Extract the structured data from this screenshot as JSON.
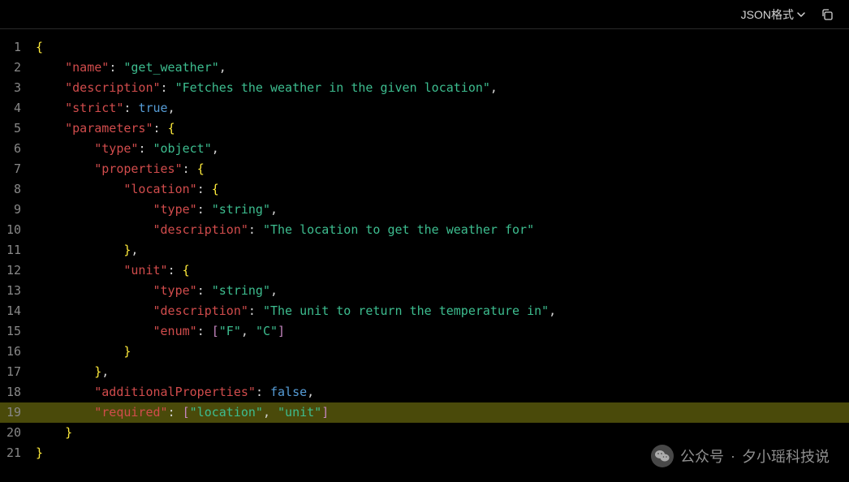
{
  "toolbar": {
    "format_label": "JSON格式"
  },
  "watermark": {
    "label": "公众号",
    "sep": "·",
    "name": "夕小瑶科技说"
  },
  "lines": [
    {
      "num": "1",
      "hl": false,
      "indent": 0,
      "segs": [
        {
          "t": "{",
          "c": "brace"
        }
      ]
    },
    {
      "num": "2",
      "hl": false,
      "indent": 1,
      "segs": [
        {
          "t": "\"name\"",
          "c": "key"
        },
        {
          "t": ": ",
          "c": "punct"
        },
        {
          "t": "\"get_weather\"",
          "c": "string"
        },
        {
          "t": ",",
          "c": "punct"
        }
      ]
    },
    {
      "num": "3",
      "hl": false,
      "indent": 1,
      "segs": [
        {
          "t": "\"description\"",
          "c": "key"
        },
        {
          "t": ": ",
          "c": "punct"
        },
        {
          "t": "\"Fetches the weather in the given location\"",
          "c": "string"
        },
        {
          "t": ",",
          "c": "punct"
        }
      ]
    },
    {
      "num": "4",
      "hl": false,
      "indent": 1,
      "segs": [
        {
          "t": "\"strict\"",
          "c": "key"
        },
        {
          "t": ": ",
          "c": "punct"
        },
        {
          "t": "true",
          "c": "bool"
        },
        {
          "t": ",",
          "c": "punct"
        }
      ]
    },
    {
      "num": "5",
      "hl": false,
      "indent": 1,
      "segs": [
        {
          "t": "\"parameters\"",
          "c": "key"
        },
        {
          "t": ": ",
          "c": "punct"
        },
        {
          "t": "{",
          "c": "brace"
        }
      ]
    },
    {
      "num": "6",
      "hl": false,
      "indent": 2,
      "segs": [
        {
          "t": "\"type\"",
          "c": "key"
        },
        {
          "t": ": ",
          "c": "punct"
        },
        {
          "t": "\"object\"",
          "c": "string"
        },
        {
          "t": ",",
          "c": "punct"
        }
      ]
    },
    {
      "num": "7",
      "hl": false,
      "indent": 2,
      "segs": [
        {
          "t": "\"properties\"",
          "c": "key"
        },
        {
          "t": ": ",
          "c": "punct"
        },
        {
          "t": "{",
          "c": "brace"
        }
      ]
    },
    {
      "num": "8",
      "hl": false,
      "indent": 3,
      "segs": [
        {
          "t": "\"location\"",
          "c": "key"
        },
        {
          "t": ": ",
          "c": "punct"
        },
        {
          "t": "{",
          "c": "brace"
        }
      ]
    },
    {
      "num": "9",
      "hl": false,
      "indent": 4,
      "segs": [
        {
          "t": "\"type\"",
          "c": "key"
        },
        {
          "t": ": ",
          "c": "punct"
        },
        {
          "t": "\"string\"",
          "c": "string"
        },
        {
          "t": ",",
          "c": "punct"
        }
      ]
    },
    {
      "num": "10",
      "hl": false,
      "indent": 4,
      "segs": [
        {
          "t": "\"description\"",
          "c": "key"
        },
        {
          "t": ": ",
          "c": "punct"
        },
        {
          "t": "\"The location to get the weather for\"",
          "c": "string"
        }
      ]
    },
    {
      "num": "11",
      "hl": false,
      "indent": 3,
      "segs": [
        {
          "t": "}",
          "c": "brace"
        },
        {
          "t": ",",
          "c": "punct"
        }
      ]
    },
    {
      "num": "12",
      "hl": false,
      "indent": 3,
      "segs": [
        {
          "t": "\"unit\"",
          "c": "key"
        },
        {
          "t": ": ",
          "c": "punct"
        },
        {
          "t": "{",
          "c": "brace"
        }
      ]
    },
    {
      "num": "13",
      "hl": false,
      "indent": 4,
      "segs": [
        {
          "t": "\"type\"",
          "c": "key"
        },
        {
          "t": ": ",
          "c": "punct"
        },
        {
          "t": "\"string\"",
          "c": "string"
        },
        {
          "t": ",",
          "c": "punct"
        }
      ]
    },
    {
      "num": "14",
      "hl": false,
      "indent": 4,
      "segs": [
        {
          "t": "\"description\"",
          "c": "key"
        },
        {
          "t": ": ",
          "c": "punct"
        },
        {
          "t": "\"The unit to return the temperature in\"",
          "c": "string"
        },
        {
          "t": ",",
          "c": "punct"
        }
      ]
    },
    {
      "num": "15",
      "hl": false,
      "indent": 4,
      "segs": [
        {
          "t": "\"enum\"",
          "c": "key"
        },
        {
          "t": ": ",
          "c": "punct"
        },
        {
          "t": "[",
          "c": "bracket"
        },
        {
          "t": "\"F\"",
          "c": "string"
        },
        {
          "t": ", ",
          "c": "punct"
        },
        {
          "t": "\"C\"",
          "c": "string"
        },
        {
          "t": "]",
          "c": "bracket"
        }
      ]
    },
    {
      "num": "16",
      "hl": false,
      "indent": 3,
      "segs": [
        {
          "t": "}",
          "c": "brace"
        }
      ]
    },
    {
      "num": "17",
      "hl": false,
      "indent": 2,
      "segs": [
        {
          "t": "}",
          "c": "brace"
        },
        {
          "t": ",",
          "c": "punct"
        }
      ]
    },
    {
      "num": "18",
      "hl": false,
      "indent": 2,
      "segs": [
        {
          "t": "\"additionalProperties\"",
          "c": "key"
        },
        {
          "t": ": ",
          "c": "punct"
        },
        {
          "t": "false",
          "c": "bool"
        },
        {
          "t": ",",
          "c": "punct"
        }
      ]
    },
    {
      "num": "19",
      "hl": true,
      "indent": 2,
      "segs": [
        {
          "t": "\"required\"",
          "c": "key"
        },
        {
          "t": ": ",
          "c": "punct"
        },
        {
          "t": "[",
          "c": "bracket"
        },
        {
          "t": "\"location\"",
          "c": "string"
        },
        {
          "t": ", ",
          "c": "punct"
        },
        {
          "t": "\"unit\"",
          "c": "string"
        },
        {
          "t": "]",
          "c": "bracket"
        }
      ]
    },
    {
      "num": "20",
      "hl": false,
      "indent": 1,
      "segs": [
        {
          "t": "}",
          "c": "brace"
        }
      ]
    },
    {
      "num": "21",
      "hl": false,
      "indent": 0,
      "segs": [
        {
          "t": "}",
          "c": "brace"
        }
      ]
    }
  ],
  "indent_unit": "    "
}
